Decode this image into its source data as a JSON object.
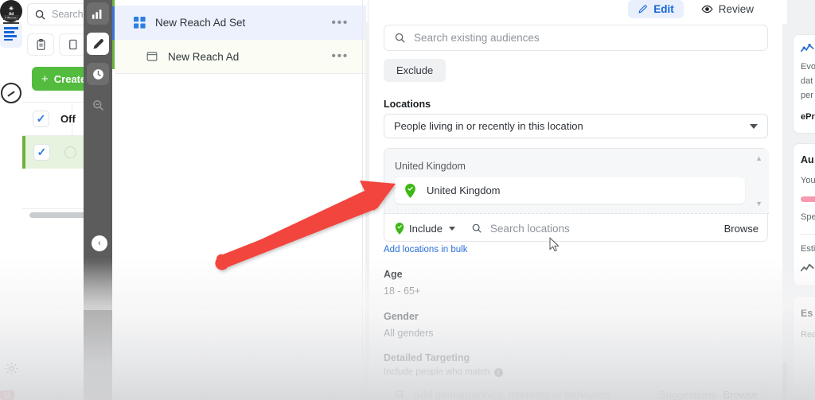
{
  "app_rail": {
    "items": [
      {
        "name": "menu",
        "icon": "hamburger-icon",
        "label": ""
      },
      {
        "name": "library",
        "icon": "ad-library-icon",
        "label": "Ad Library"
      },
      {
        "name": "speed",
        "icon": "speedometer-icon",
        "label": ""
      },
      {
        "name": "table",
        "icon": "table-icon",
        "label": ""
      },
      {
        "name": "settings",
        "icon": "gear-icon",
        "label": ""
      }
    ],
    "notification_badge": "11"
  },
  "list_panel": {
    "search_placeholder": "Search",
    "create_button": "Create",
    "create_plus": "+",
    "tools": [
      "clipboard-icon",
      "duplicate-icon"
    ],
    "row_header_label": "Off",
    "checkmark": "✓"
  },
  "dark_toolbar": {
    "buttons": [
      {
        "name": "chart-tool",
        "icon": "bar-chart-icon",
        "active": false
      },
      {
        "name": "edit-tool",
        "icon": "pencil-icon",
        "active": true
      },
      {
        "name": "history-tool",
        "icon": "clock-icon",
        "active": false
      },
      {
        "name": "zoom-out-tool",
        "icon": "magnifier-minus-icon",
        "active": false
      }
    ],
    "collapse_glyph": "‹"
  },
  "object_list": {
    "rows": [
      {
        "label": "New Reach Ad Set",
        "icon": "adset-grid-icon",
        "menu": "•••",
        "selected": true
      },
      {
        "label": "New Reach Ad",
        "icon": "ad-card-icon",
        "menu": "•••",
        "selected": false
      }
    ]
  },
  "main": {
    "tabs": [
      {
        "label": "Edit",
        "icon": "pencil-icon",
        "active": true
      },
      {
        "label": "Review",
        "icon": "eye-icon",
        "active": false
      }
    ],
    "audience_search_placeholder": "Search existing audiences",
    "exclude_button": "Exclude",
    "locations": {
      "section_label": "Locations",
      "scope_value": "People living in or recently in this location",
      "group_title": "United Kingdom",
      "selected_location": "United Kingdom",
      "include_label": "Include",
      "search_placeholder": "Search locations",
      "browse_label": "Browse",
      "bulk_link": "Add locations in bulk"
    },
    "age": {
      "label": "Age",
      "value": "18 - 65+"
    },
    "gender": {
      "label": "Gender",
      "value": "All genders"
    },
    "detailed_targeting": {
      "label": "Detailed Targeting",
      "sub_label": "Include people who match",
      "info_glyph": "i",
      "placeholder": "Add demographics, interests or behaviors",
      "suggestions_label": "Suggestions",
      "browse_label": "Browse"
    }
  },
  "right_panel": {
    "card1": {
      "lines": [
        "Evo",
        "dat",
        "per"
      ],
      "bold": "ePr"
    },
    "card2": {
      "title": "Au",
      "lines": [
        "You",
        "Spe",
        "Esti"
      ]
    },
    "card3": {
      "title": "Es",
      "lines": [
        "Rea"
      ]
    }
  },
  "colors": {
    "accent_blue": "#1266d6",
    "green": "#53bc3e",
    "pin_green": "#3db815",
    "arrow_red": "#f2443d",
    "dark_toolbar": "#5c5c5c",
    "selected_row": "#edf1fd"
  }
}
